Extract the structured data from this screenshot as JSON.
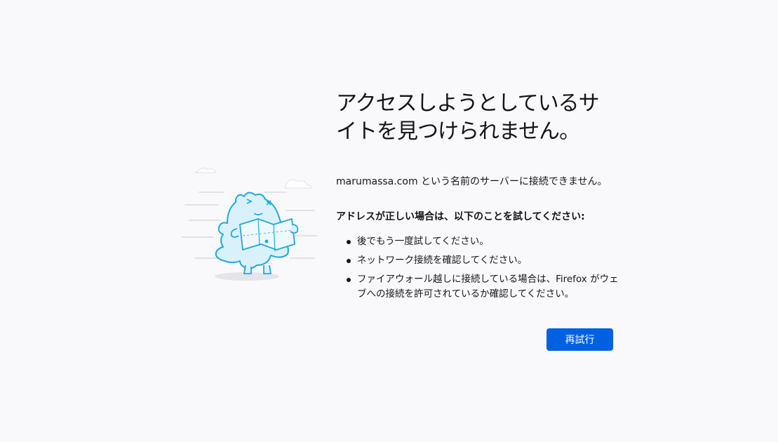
{
  "error_page": {
    "title": "アクセスしようとしているサイトを見つけられません。",
    "description": "marumassa.com という名前のサーバーに接続できません。",
    "advice_heading": "アドレスが正しい場合は、以下のことを試してください:",
    "advice_items": [
      "後でもう一度試してください。",
      "ネットワーク接続を確認してください。",
      "ファイアウォール越しに接続している場合は、Firefox がウェブへの接続を許可されているか確認してください。"
    ],
    "retry_label": "再試行",
    "illustration": "confused-dinosaur-with-map",
    "colors": {
      "background": "#f9f9fb",
      "accent": "#0061e0",
      "text": "#15141a",
      "illustration_fill": "#d9f1fb",
      "illustration_stroke": "#1fa8db"
    }
  }
}
